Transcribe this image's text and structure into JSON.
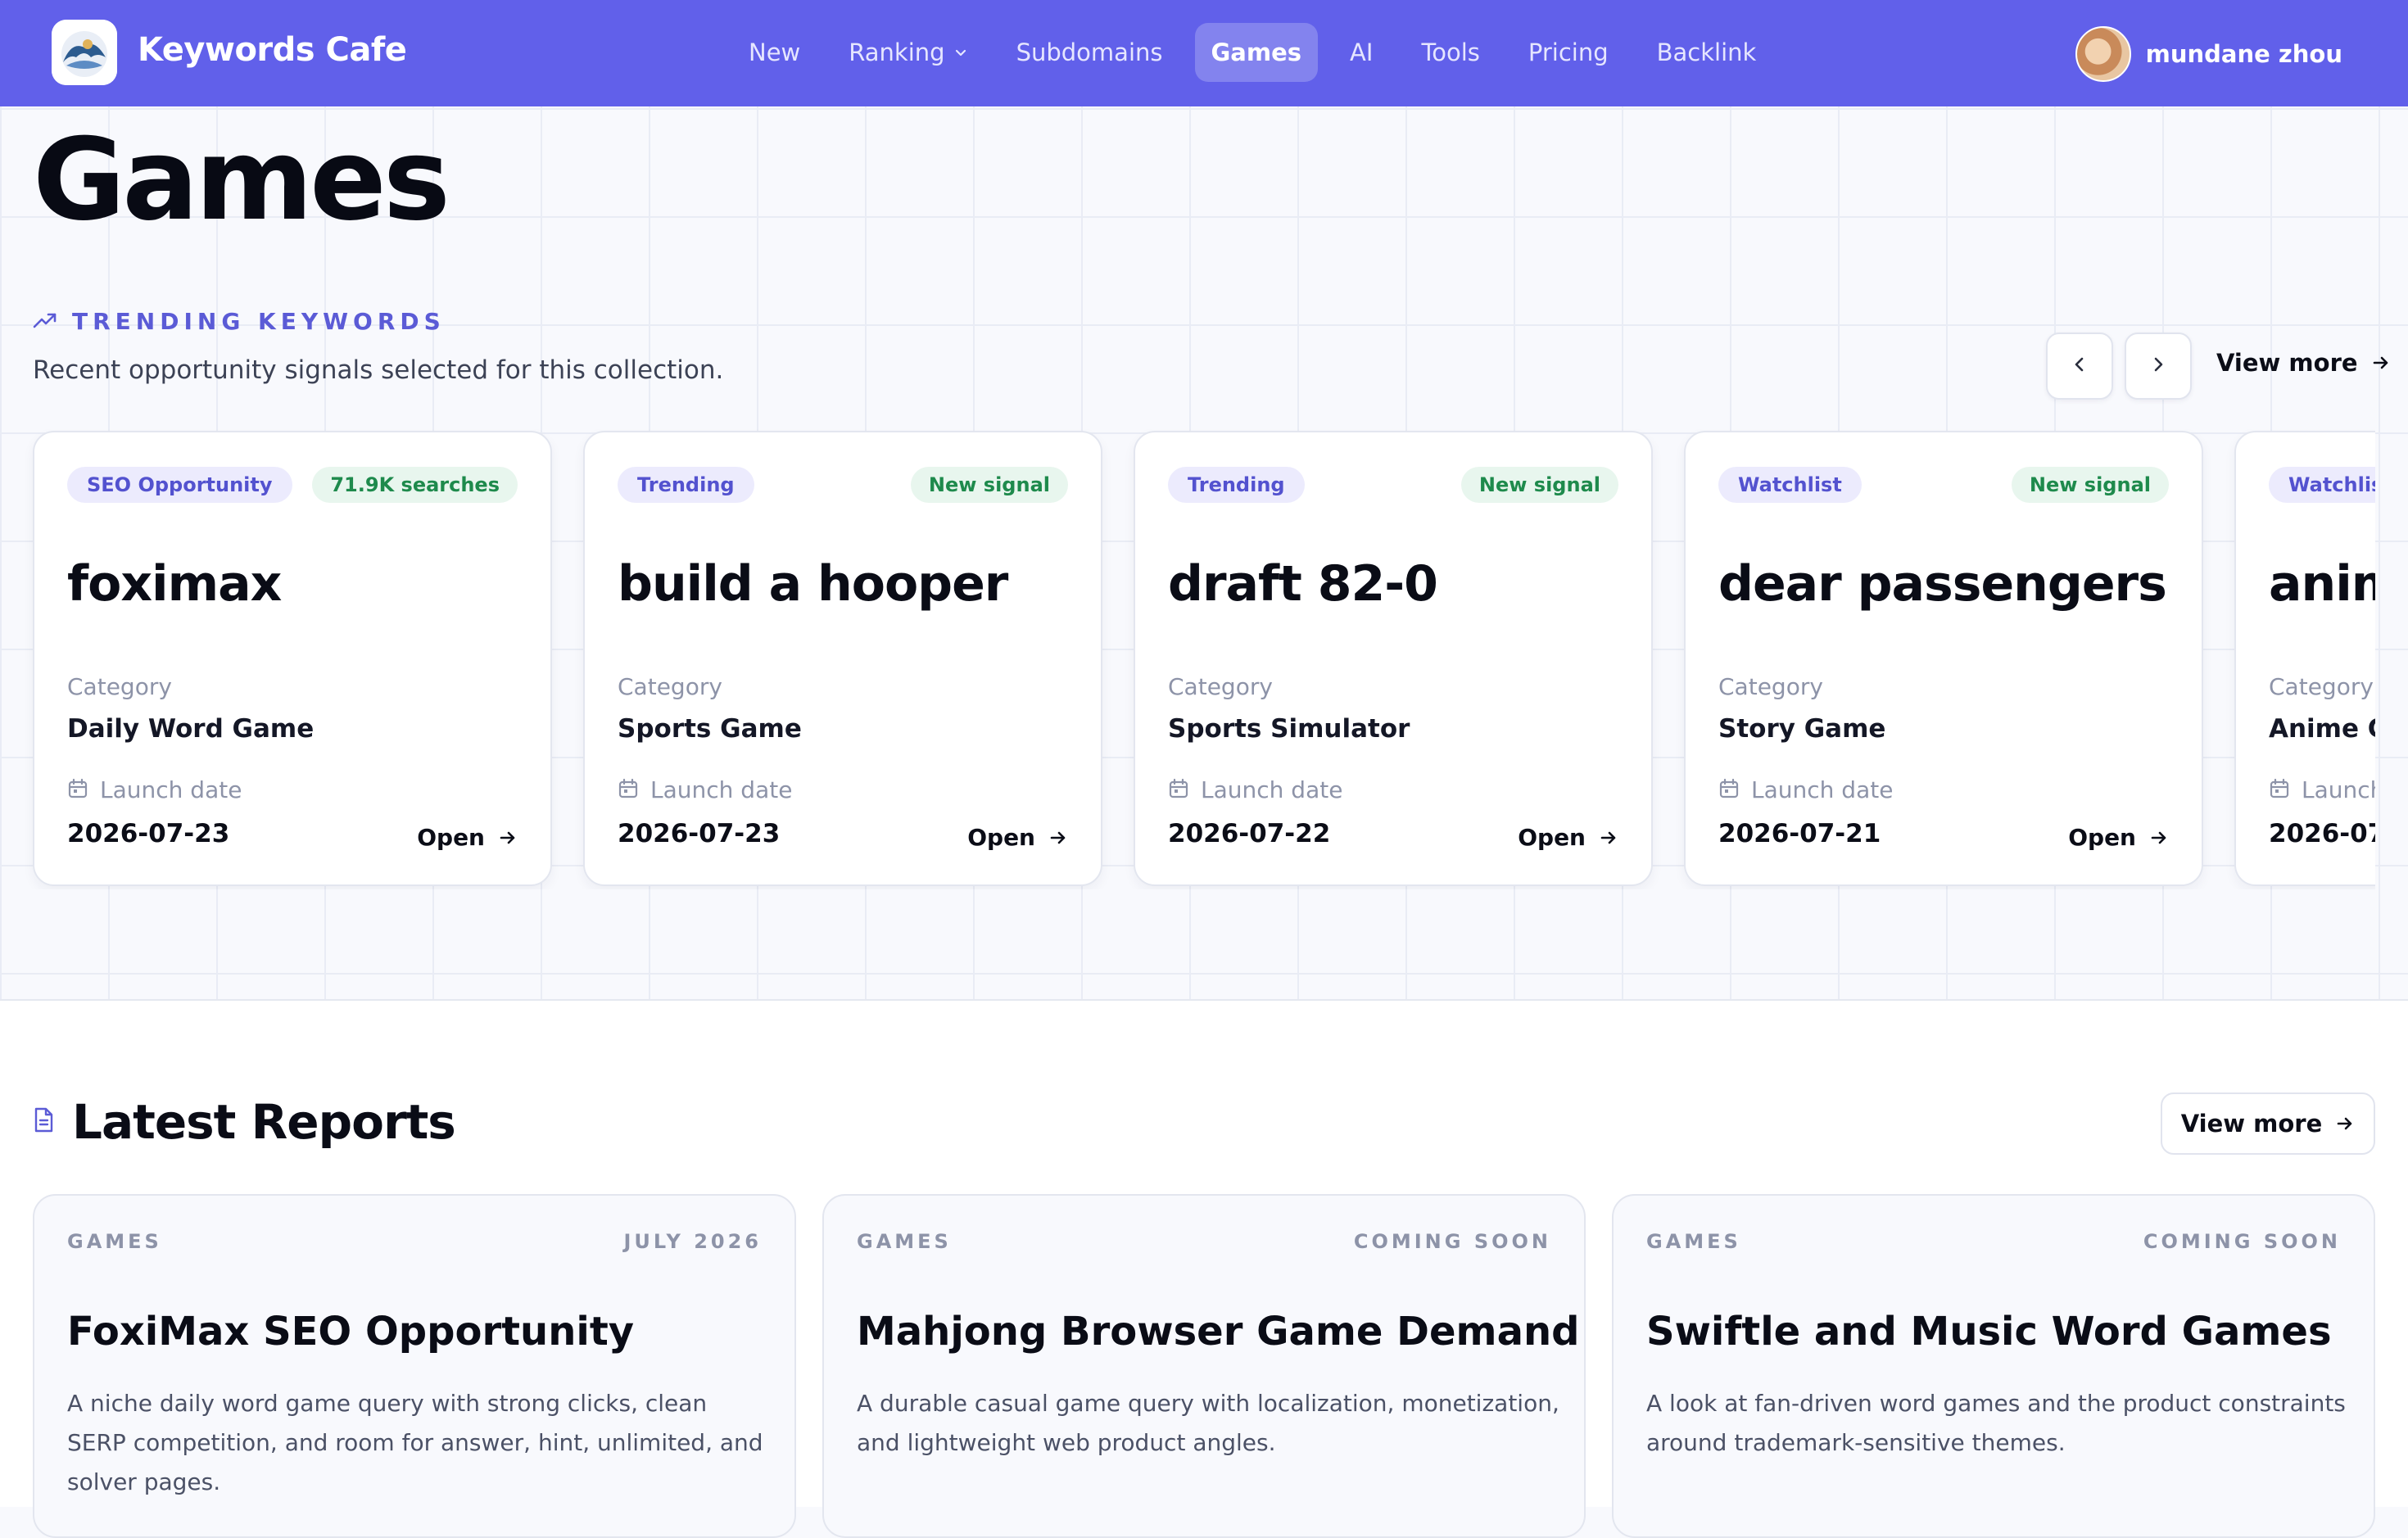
{
  "nav": {
    "brand": "Keywords Cafe",
    "links": [
      {
        "label": "New"
      },
      {
        "label": "Ranking",
        "has_dropdown": true
      },
      {
        "label": "Subdomains"
      },
      {
        "label": "Games",
        "active": true
      },
      {
        "label": "AI"
      },
      {
        "label": "Tools"
      },
      {
        "label": "Pricing"
      },
      {
        "label": "Backlink"
      }
    ],
    "user_name": "mundane zhou"
  },
  "page_title": "Games",
  "trending": {
    "label": "TRENDING KEYWORDS",
    "subtitle": "Recent opportunity signals selected for this collection.",
    "view_more": "View more",
    "cards": [
      {
        "badge_left": "SEO Opportunity",
        "badge_right": "71.9K searches",
        "keyword": "foximax",
        "category_label": "Category",
        "category": "Daily Word Game",
        "launch_label": "Launch date",
        "launch_date": "2026-07-23",
        "open_label": "Open"
      },
      {
        "badge_left": "Trending",
        "badge_right": "New signal",
        "keyword": "build a hooper",
        "category_label": "Category",
        "category": "Sports Game",
        "launch_label": "Launch date",
        "launch_date": "2026-07-23",
        "open_label": "Open"
      },
      {
        "badge_left": "Trending",
        "badge_right": "New signal",
        "keyword": "draft 82-0",
        "category_label": "Category",
        "category": "Sports Simulator",
        "launch_label": "Launch date",
        "launch_date": "2026-07-22",
        "open_label": "Open"
      },
      {
        "badge_left": "Watchlist",
        "badge_right": "New signal",
        "keyword": "dear passengers",
        "category_label": "Category",
        "category": "Story Game",
        "launch_label": "Launch date",
        "launch_date": "2026-07-21",
        "open_label": "Open"
      },
      {
        "badge_left": "Watchlist",
        "badge_right": "",
        "keyword": "anim",
        "category_label": "Category",
        "category": "Anime G",
        "launch_label": "Launch",
        "launch_date": "2026-07-",
        "open_label": ""
      }
    ]
  },
  "reports": {
    "title": "Latest Reports",
    "view_more": "View more",
    "items": [
      {
        "category": "GAMES",
        "date": "JULY 2026",
        "title": "FoxiMax SEO Opportunity",
        "description": "A niche daily word game query with strong clicks, clean SERP competition, and room for answer, hint, unlimited, and solver pages."
      },
      {
        "category": "GAMES",
        "date": "COMING SOON",
        "title": "Mahjong Browser Game Demand",
        "description": "A durable casual game query with localization, monetization, and lightweight web product angles."
      },
      {
        "category": "GAMES",
        "date": "COMING SOON",
        "title": "Swiftle and Music Word Games",
        "description": "A look at fan-driven word games and the product constraints around trademark-sensitive themes."
      }
    ]
  },
  "icons": {
    "trend": "trending-up-icon",
    "calendar": "calendar-icon",
    "arrow": "arrow-right-icon",
    "report": "document-icon",
    "prev": "chevron-left-icon",
    "next": "chevron-right-icon"
  },
  "colors": {
    "nav_bg": "#6160ea",
    "accent": "#5b5bd6",
    "badge_purple_bg": "#ecebfd",
    "badge_green_bg": "#e8f6ee",
    "badge_green_text": "#1e8a4c"
  }
}
